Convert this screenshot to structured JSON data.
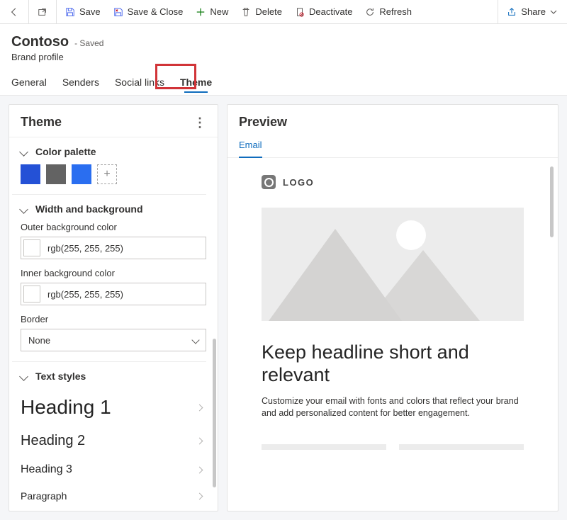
{
  "commands": {
    "back_icon": "back",
    "open_icon": "open-new-window",
    "save": "Save",
    "save_close": "Save & Close",
    "new": "New",
    "delete": "Delete",
    "deactivate": "Deactivate",
    "refresh": "Refresh",
    "share": "Share"
  },
  "header": {
    "title": "Contoso",
    "save_status": "- Saved",
    "subtitle": "Brand profile"
  },
  "tabs": {
    "general": "General",
    "senders": "Senders",
    "social": "Social links",
    "theme": "Theme",
    "active": "theme"
  },
  "theme": {
    "panel_title": "Theme",
    "sections": {
      "palette": {
        "title": "Color palette",
        "colors": [
          "#2451d6",
          "#636363",
          "#2a6ef0"
        ],
        "add_label": "+"
      },
      "width_bg": {
        "title": "Width and background",
        "outer_label": "Outer background color",
        "outer_value": "rgb(255, 255, 255)",
        "inner_label": "Inner background color",
        "inner_value": "rgb(255, 255, 255)",
        "border_label": "Border",
        "border_value": "None"
      },
      "text_styles": {
        "title": "Text styles",
        "h1": "Heading 1",
        "h2": "Heading 2",
        "h3": "Heading 3",
        "p": "Paragraph"
      }
    }
  },
  "preview": {
    "panel_title": "Preview",
    "tab": "Email",
    "logo_text": "LOGO",
    "headline": "Keep headline short and relevant",
    "body": "Customize your email with fonts and colors that reflect your brand and add personalized content for better engagement."
  }
}
